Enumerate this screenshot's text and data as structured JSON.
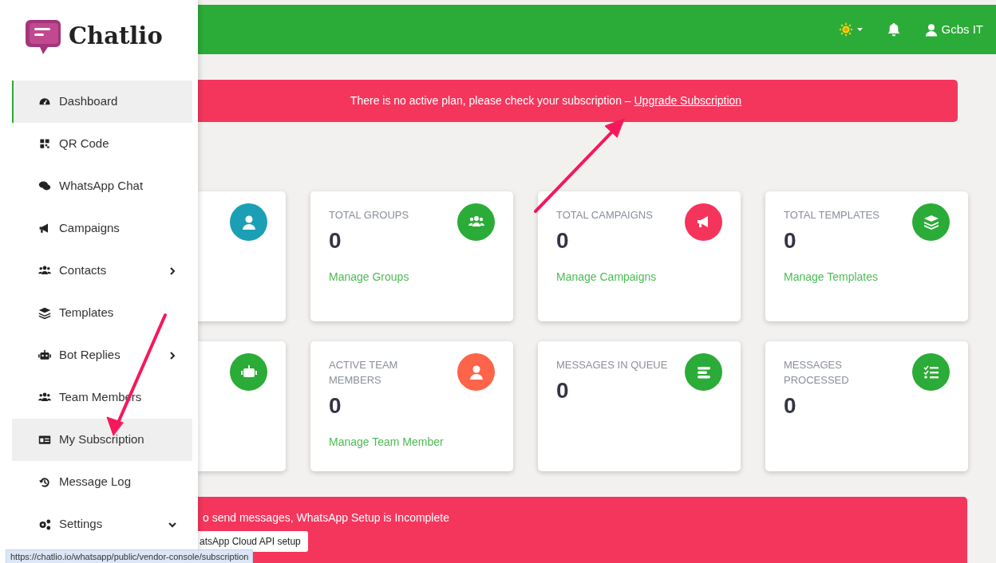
{
  "brand": {
    "name": "Chatlio"
  },
  "sidebar": {
    "items": [
      {
        "label": "Dashboard",
        "kind": "link",
        "selected": true,
        "hovered": false
      },
      {
        "label": "QR Code",
        "kind": "link",
        "selected": false,
        "hovered": false
      },
      {
        "label": "WhatsApp Chat",
        "kind": "link",
        "selected": false,
        "hovered": false
      },
      {
        "label": "Campaigns",
        "kind": "link",
        "selected": false,
        "hovered": false
      },
      {
        "label": "Contacts",
        "kind": "submenu",
        "selected": false,
        "hovered": false
      },
      {
        "label": "Templates",
        "kind": "link",
        "selected": false,
        "hovered": false
      },
      {
        "label": "Bot Replies",
        "kind": "submenu",
        "selected": false,
        "hovered": false
      },
      {
        "label": "Team Members",
        "kind": "link",
        "selected": false,
        "hovered": false
      },
      {
        "label": "My Subscription",
        "kind": "link",
        "selected": false,
        "hovered": true
      },
      {
        "label": "Message Log",
        "kind": "link",
        "selected": false,
        "hovered": false
      },
      {
        "label": "Settings",
        "kind": "dropdown",
        "selected": false,
        "hovered": false
      }
    ]
  },
  "topbar": {
    "user": "Gcbs IT"
  },
  "plan_alert": {
    "text": "There is no active plan, please check your subscription – ",
    "link": "Upgrade Subscription"
  },
  "cards": [
    {
      "color": "#1b9fb5"
    },
    {
      "title": "TOTAL GROUPS",
      "value": "0",
      "link": "Manage Groups",
      "color": "#2bab37"
    },
    {
      "title": "TOTAL CAMPAIGNS",
      "value": "0",
      "link": "Manage Campaigns",
      "color": "#f5345c"
    },
    {
      "title": "TOTAL TEMPLATES",
      "value": "0",
      "link": "Manage Templates",
      "color": "#2bab37"
    },
    {
      "color": "#2bab37"
    },
    {
      "title": "ACTIVE TEAM MEMBERS",
      "value": "0",
      "link": "Manage Team Member",
      "color": "#fd6449"
    },
    {
      "title": "MESSAGES IN QUEUE",
      "value": "0",
      "color": "#2bab37"
    },
    {
      "title": "MESSAGES PROCESSED",
      "value": "0",
      "color": "#2bab37"
    }
  ],
  "setup_alert": {
    "text": "o send messages, WhatsApp Setup is Incomplete",
    "button": "atsApp Cloud API setup"
  },
  "status_url": "https://chatlio.io/whatsapp/public/vendor-console/subscription"
}
